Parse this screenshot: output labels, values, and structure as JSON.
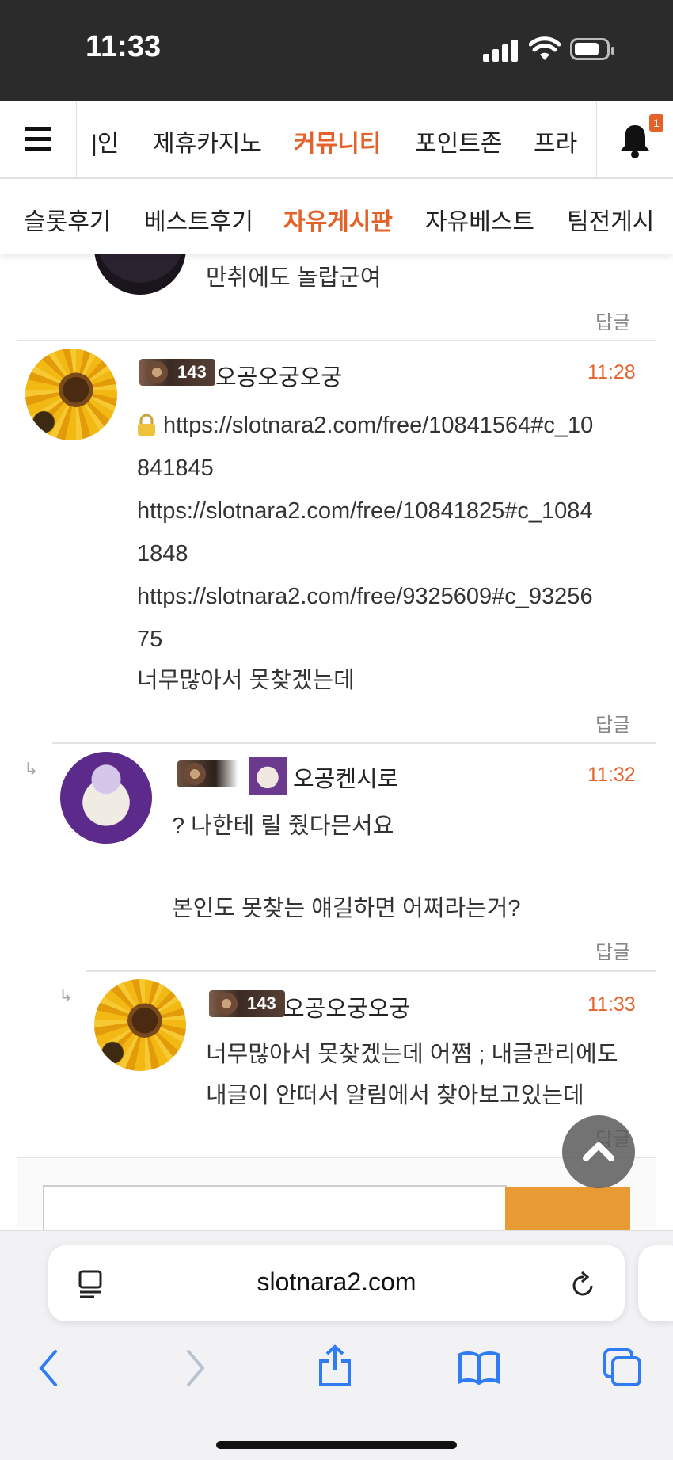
{
  "status_bar": {
    "time": "11:33"
  },
  "top_nav": {
    "items": [
      "|인",
      "제휴카지노",
      "커뮤니티",
      "포인트존",
      "프라"
    ],
    "active": "커뮤니티",
    "notification_count": "1"
  },
  "sub_nav": {
    "items": [
      "슬롯후기",
      "베스트후기",
      "자유게시판",
      "자유베스트",
      "팀전게시"
    ],
    "active": "자유게시판"
  },
  "comments": [
    {
      "text": "만취에도 놀랍군여",
      "reply_label": "답글"
    },
    {
      "level": "143",
      "author": "오공오궁오궁",
      "time": "11:28",
      "lines": [
        "https://slotnara2.com/free/10841564#c_10",
        "841845",
        "https://slotnara2.com/free/10841825#c_1084",
        "1848",
        "https://slotnara2.com/free/9325609#c_93256",
        "75",
        "너무많아서 못찾겠는데"
      ],
      "reply_label": "답글"
    },
    {
      "author": "오공켄시로",
      "time": "11:32",
      "lines": [
        "? 나한테 릴 줬다믄서요",
        "",
        "본인도 못찾는 얘길하면 어쩌라는거?"
      ],
      "reply_label": "답글"
    },
    {
      "level": "143",
      "author": "오공오궁오궁",
      "time": "11:33",
      "lines": [
        "너무많아서 못찾겠는데 어쩜 ; 내글관리에도",
        "내글이 안떠서 알림에서 찾아보고있는데"
      ],
      "reply_label": "답글"
    }
  ],
  "browser": {
    "url": "slotnara2.com"
  },
  "colors": {
    "accent": "#e4612a",
    "submit": "#e89a35"
  }
}
